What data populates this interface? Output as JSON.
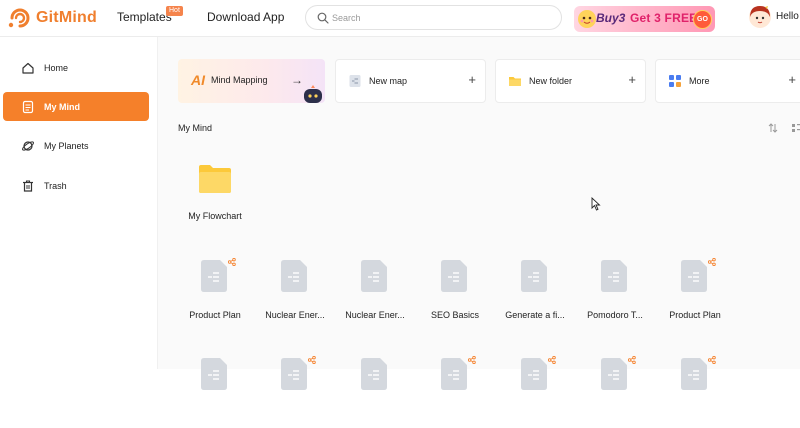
{
  "header": {
    "logo_text": "GitMind",
    "nav": {
      "templates": "Templates",
      "hot_badge": "Hot",
      "download": "Download App"
    },
    "search": {
      "placeholder": "Search",
      "value": ""
    },
    "promo": {
      "buy": "Buy3",
      "free": "Get 3 FREE",
      "go": "GO"
    },
    "greeting": "Hello"
  },
  "sidebar": {
    "items": [
      {
        "label": "Home",
        "icon": "home-icon",
        "active": false
      },
      {
        "label": "My Mind",
        "icon": "document-icon",
        "active": true
      },
      {
        "label": "My Planets",
        "icon": "planet-icon",
        "active": false
      },
      {
        "label": "Trash",
        "icon": "trash-icon",
        "active": false
      }
    ]
  },
  "quick_actions": [
    {
      "label": "Mind Mapping",
      "icon": "ai-icon",
      "action": "arrow-right-icon"
    },
    {
      "label": "New map",
      "icon": "new-map-icon",
      "action": "plus-icon"
    },
    {
      "label": "New folder",
      "icon": "folder-icon",
      "action": "plus-icon"
    },
    {
      "label": "More",
      "icon": "grid-apps-icon",
      "action": "plus-icon"
    }
  ],
  "section_title": "My Mind",
  "folders": [
    {
      "name": "My Flowchart"
    }
  ],
  "files_row1": [
    {
      "name": "Product Plan",
      "shared": true
    },
    {
      "name": "Nuclear Ener...",
      "shared": false
    },
    {
      "name": "Nuclear Ener...",
      "shared": false
    },
    {
      "name": "SEO Basics",
      "shared": false
    },
    {
      "name": "Generate a fi...",
      "shared": false
    },
    {
      "name": "Pomodoro T...",
      "shared": false
    },
    {
      "name": "Product Plan",
      "shared": true
    }
  ],
  "files_row2": [
    {
      "shared": false
    },
    {
      "shared": true
    },
    {
      "shared": false
    },
    {
      "shared": true
    },
    {
      "shared": true
    },
    {
      "shared": true
    },
    {
      "shared": true
    }
  ],
  "colors": {
    "accent": "#f5802a",
    "doc_gray": "#d4d8de",
    "folder_yellow": "#fcd25a"
  }
}
